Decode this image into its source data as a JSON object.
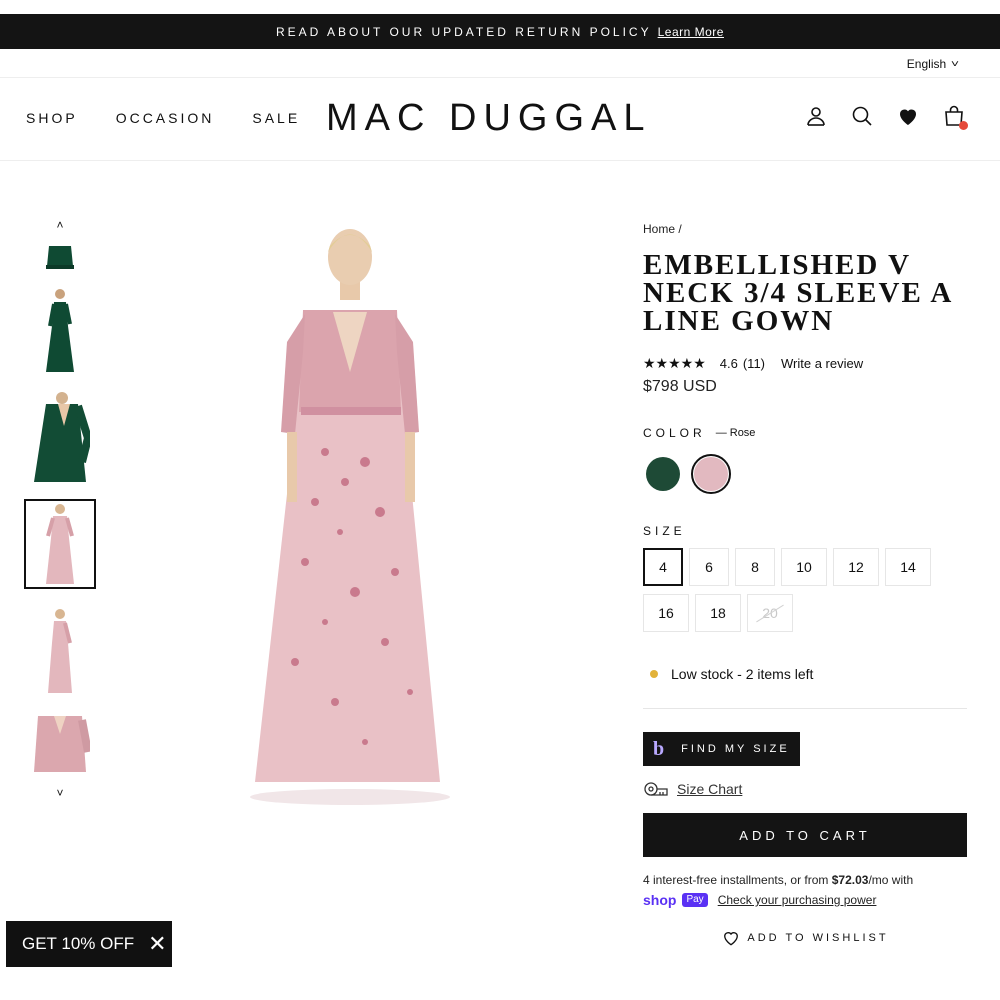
{
  "announcement": {
    "text": "READ ABOUT OUR UPDATED RETURN POLICY",
    "link": "Learn More"
  },
  "language": {
    "value": "English",
    "icon": "chevron-down-icon"
  },
  "nav": {
    "items": [
      "SHOP",
      "OCCASION",
      "SALE"
    ]
  },
  "logo": "MAC DUGGAL",
  "header_icons": [
    "account-icon",
    "search-icon",
    "heart-icon",
    "cart-icon"
  ],
  "gallery": {
    "up_arrow": "˄",
    "down_arrow": "˅",
    "thumbnails": [
      "emerald gown hem",
      "emerald gown full",
      "emerald gown detail",
      "rose gown front",
      "rose gown side",
      "rose gown detail"
    ],
    "active_index": 3
  },
  "product": {
    "breadcrumb": "Home /",
    "title": "EMBELLISHED V NECK 3/4 SLEEVE A LINE GOWN",
    "stars": "★★★★★",
    "rating": "4.6",
    "review_count": "(11)",
    "write_review": "Write a review",
    "price": "$798 USD",
    "color_label": "COLOR",
    "color_value": "— Rose",
    "colors": [
      {
        "name": "Emerald",
        "hex": "#1e4a36",
        "selected": false
      },
      {
        "name": "Rose",
        "hex": "#e2b9c0",
        "selected": true
      }
    ],
    "size_label": "SIZE",
    "sizes": [
      {
        "label": "4",
        "selected": true,
        "available": true
      },
      {
        "label": "6",
        "selected": false,
        "available": true
      },
      {
        "label": "8",
        "selected": false,
        "available": true
      },
      {
        "label": "10",
        "selected": false,
        "available": true
      },
      {
        "label": "12",
        "selected": false,
        "available": true
      },
      {
        "label": "14",
        "selected": false,
        "available": true
      },
      {
        "label": "16",
        "selected": false,
        "available": true
      },
      {
        "label": "18",
        "selected": false,
        "available": true
      },
      {
        "label": "20",
        "selected": false,
        "available": false
      }
    ],
    "stock": "Low stock - 2 items left",
    "find_my_size": "FIND MY SIZE",
    "find_my_size_logo": "b",
    "size_chart": "Size Chart",
    "add_to_cart": "ADD TO CART",
    "installments": {
      "pre": "4 interest-free installments, or from ",
      "amount": "$72.03",
      "post": "/mo with"
    },
    "shop_pay": {
      "shop": "shop",
      "pay": "Pay",
      "check": "Check your purchasing power"
    },
    "wishlist": "ADD TO WISHLIST"
  },
  "promo": {
    "text": "GET 10% OFF",
    "close": "✕"
  },
  "colors": {
    "dark": "#141414",
    "stock_dot": "#e2b23a",
    "cart_dot": "#e54a3a",
    "shop_pay": "#5a31f4"
  }
}
